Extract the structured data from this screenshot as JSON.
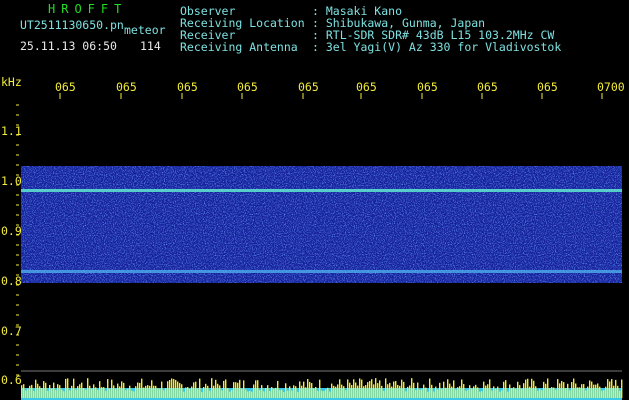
{
  "header": {
    "app_title": "HROFFT",
    "filename": "UT2511130650.pn",
    "mode": "meteor",
    "datetime": "25.11.13 06:50",
    "count": "114",
    "info_labels": [
      "Observer",
      "Receiving Location",
      "Receiver",
      "Receiving Antenna"
    ],
    "info_values": [
      ": Masaki Kano",
      ": Shibukawa, Gunma, Japan",
      ": RTL-SDR SDR# 43dB L15 103.2MHz CW",
      ": 3el Yagi(V) Az 330 for Vladivostok"
    ]
  },
  "axes": {
    "y_unit": "kHz",
    "y_ticks": [
      "1.1",
      "1.0",
      "0.9",
      "0.8",
      "0.7",
      "0.6"
    ],
    "x_ticks": [
      "065",
      "065",
      "065",
      "065",
      "065",
      "065",
      "065",
      "065",
      "065",
      "0700"
    ]
  },
  "colors": {
    "background": "#000000",
    "header_text": "#7ee0e0",
    "title_text": "#22dd22",
    "axis_text": "#f3ec3a",
    "spectrogram": "#1e2fb0",
    "signal_line": "#5fe8d0",
    "level_bars": "#f3ec3a",
    "level_base": "#39c8e8"
  }
}
